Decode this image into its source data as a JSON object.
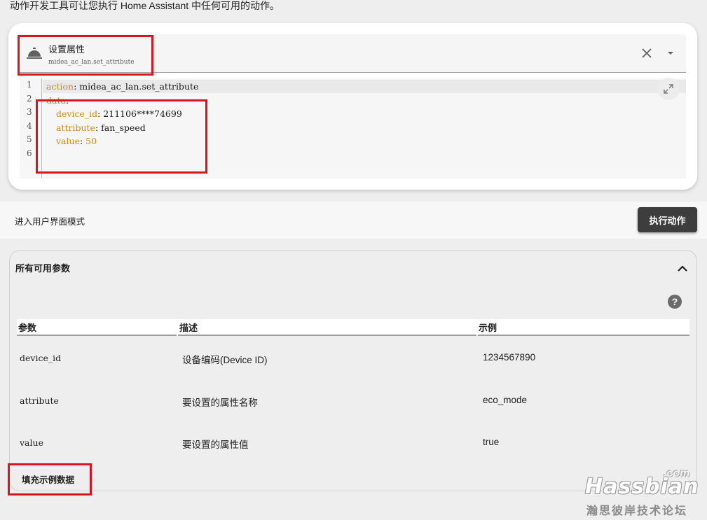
{
  "intro_text": "动作开发工具可让您执行 Home Assistant 中任何可用的动作。",
  "action_card": {
    "service_name": "设置属性",
    "service_id": "midea_ac_lan.set_attribute",
    "clear_icon": "close-icon",
    "dropdown_icon": "chevron-down-icon"
  },
  "editor": {
    "line_numbers": [
      "1",
      "2",
      "3",
      "4",
      "5",
      "6"
    ],
    "lines": [
      {
        "key": "action",
        "sep": ": ",
        "value": "midea_ac_lan.set_attribute"
      },
      {
        "key": "data",
        "sep": ":",
        "value": ""
      },
      {
        "key": "device_id",
        "sep": ": ",
        "value": "211106****74699"
      },
      {
        "key": "attribute",
        "sep": ": ",
        "value": "fan_speed"
      },
      {
        "key": "value",
        "sep": ": ",
        "value": "50"
      }
    ]
  },
  "mode_bar": {
    "toggle_label": "进入用户界面模式",
    "run_label": "执行动作"
  },
  "params": {
    "title": "所有可用参数",
    "headers": [
      "参数",
      "描述",
      "示例"
    ],
    "rows": [
      {
        "name": "device_id",
        "desc": "设备编码(Device ID)",
        "example": "1234567890"
      },
      {
        "name": "attribute",
        "desc": "要设置的属性名称",
        "example": "eco_mode"
      },
      {
        "name": "value",
        "desc": "要设置的属性值",
        "example": "true"
      }
    ],
    "fill_label": "填充示例数据"
  },
  "watermark": {
    "main": "Hassbian",
    "com": ".com",
    "sub": "瀚思彼岸技术论坛"
  },
  "colors": {
    "highlight": "#d9141f",
    "yaml_key": "#d4880f",
    "run_button": "#3d3d3d"
  }
}
